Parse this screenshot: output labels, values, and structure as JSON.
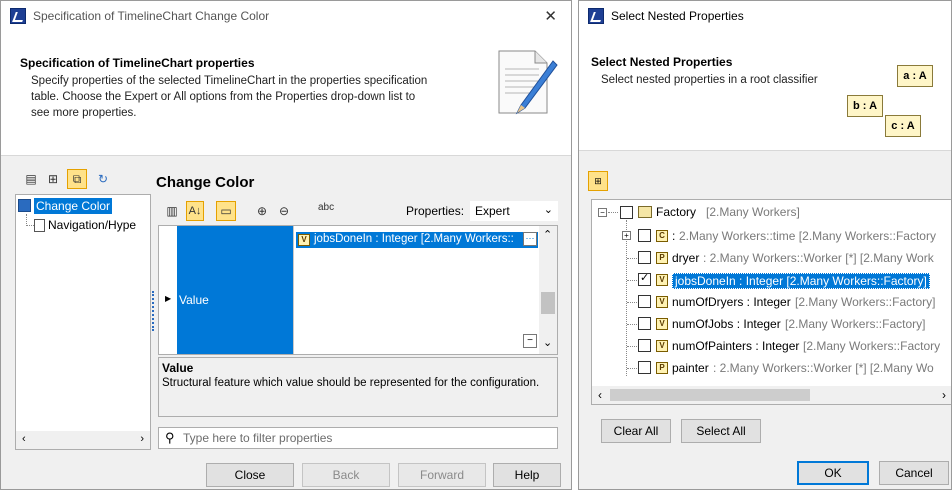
{
  "left": {
    "title": "Specification of TimelineChart Change Color",
    "banner_title": "Specification of TimelineChart properties",
    "banner_desc_1": "Specify properties of the selected TimelineChart in the properties specification",
    "banner_desc_2": "table. Choose the Expert or All options from the Properties drop-down list to",
    "banner_desc_3": "see more properties.",
    "section_title": "Change Color",
    "tree": [
      "Change Color",
      "Navigation/Hype"
    ],
    "properties_label": "Properties:",
    "properties_value": "Expert",
    "row_label": "Value",
    "row_value": "jobsDoneIn : Integer [2.Many Workers::",
    "desc_title": "Value",
    "desc_text": "Structural feature which value should be represented for the configuration.",
    "filter_placeholder": "Type here to filter properties",
    "buttons": {
      "close": "Close",
      "back": "Back",
      "forward": "Forward",
      "help": "Help"
    }
  },
  "right": {
    "title": "Select Nested Properties",
    "banner_title": "Select Nested Properties",
    "banner_desc": "Select nested properties in a root classifier",
    "graphic": {
      "a": "a : A",
      "b": "b : A",
      "c": "c : A"
    },
    "root": {
      "name": "Factory",
      "type": "[2.Many Workers]"
    },
    "items": [
      {
        "badge": "C",
        "name": ": ",
        "type": "2.Many Workers::time [2.Many Workers::Factory",
        "checked": false
      },
      {
        "badge": "P",
        "name": "dryer",
        "type": ": 2.Many Workers::Worker [*] [2.Many Work",
        "checked": false
      },
      {
        "badge": "V",
        "name": "jobsDoneIn : Integer [2.Many Workers::Factory]",
        "type": "",
        "checked": true
      },
      {
        "badge": "V",
        "name": "numOfDryers : Integer",
        "type": "[2.Many Workers::Factory]",
        "checked": false
      },
      {
        "badge": "V",
        "name": "numOfJobs : Integer",
        "type": "[2.Many Workers::Factory]",
        "checked": false
      },
      {
        "badge": "V",
        "name": "numOfPainters : Integer",
        "type": "[2.Many Workers::Factory",
        "checked": false
      },
      {
        "badge": "P",
        "name": "painter",
        "type": ": 2.Many Workers::Worker [*] [2.Many Wo",
        "checked": false
      }
    ],
    "buttons": {
      "clear_all": "Clear All",
      "select_all": "Select All",
      "ok": "OK",
      "cancel": "Cancel"
    }
  },
  "colors": {
    "accent": "#0078d7",
    "selection": "#0078d7",
    "window_bg": "#f0f0f0"
  }
}
